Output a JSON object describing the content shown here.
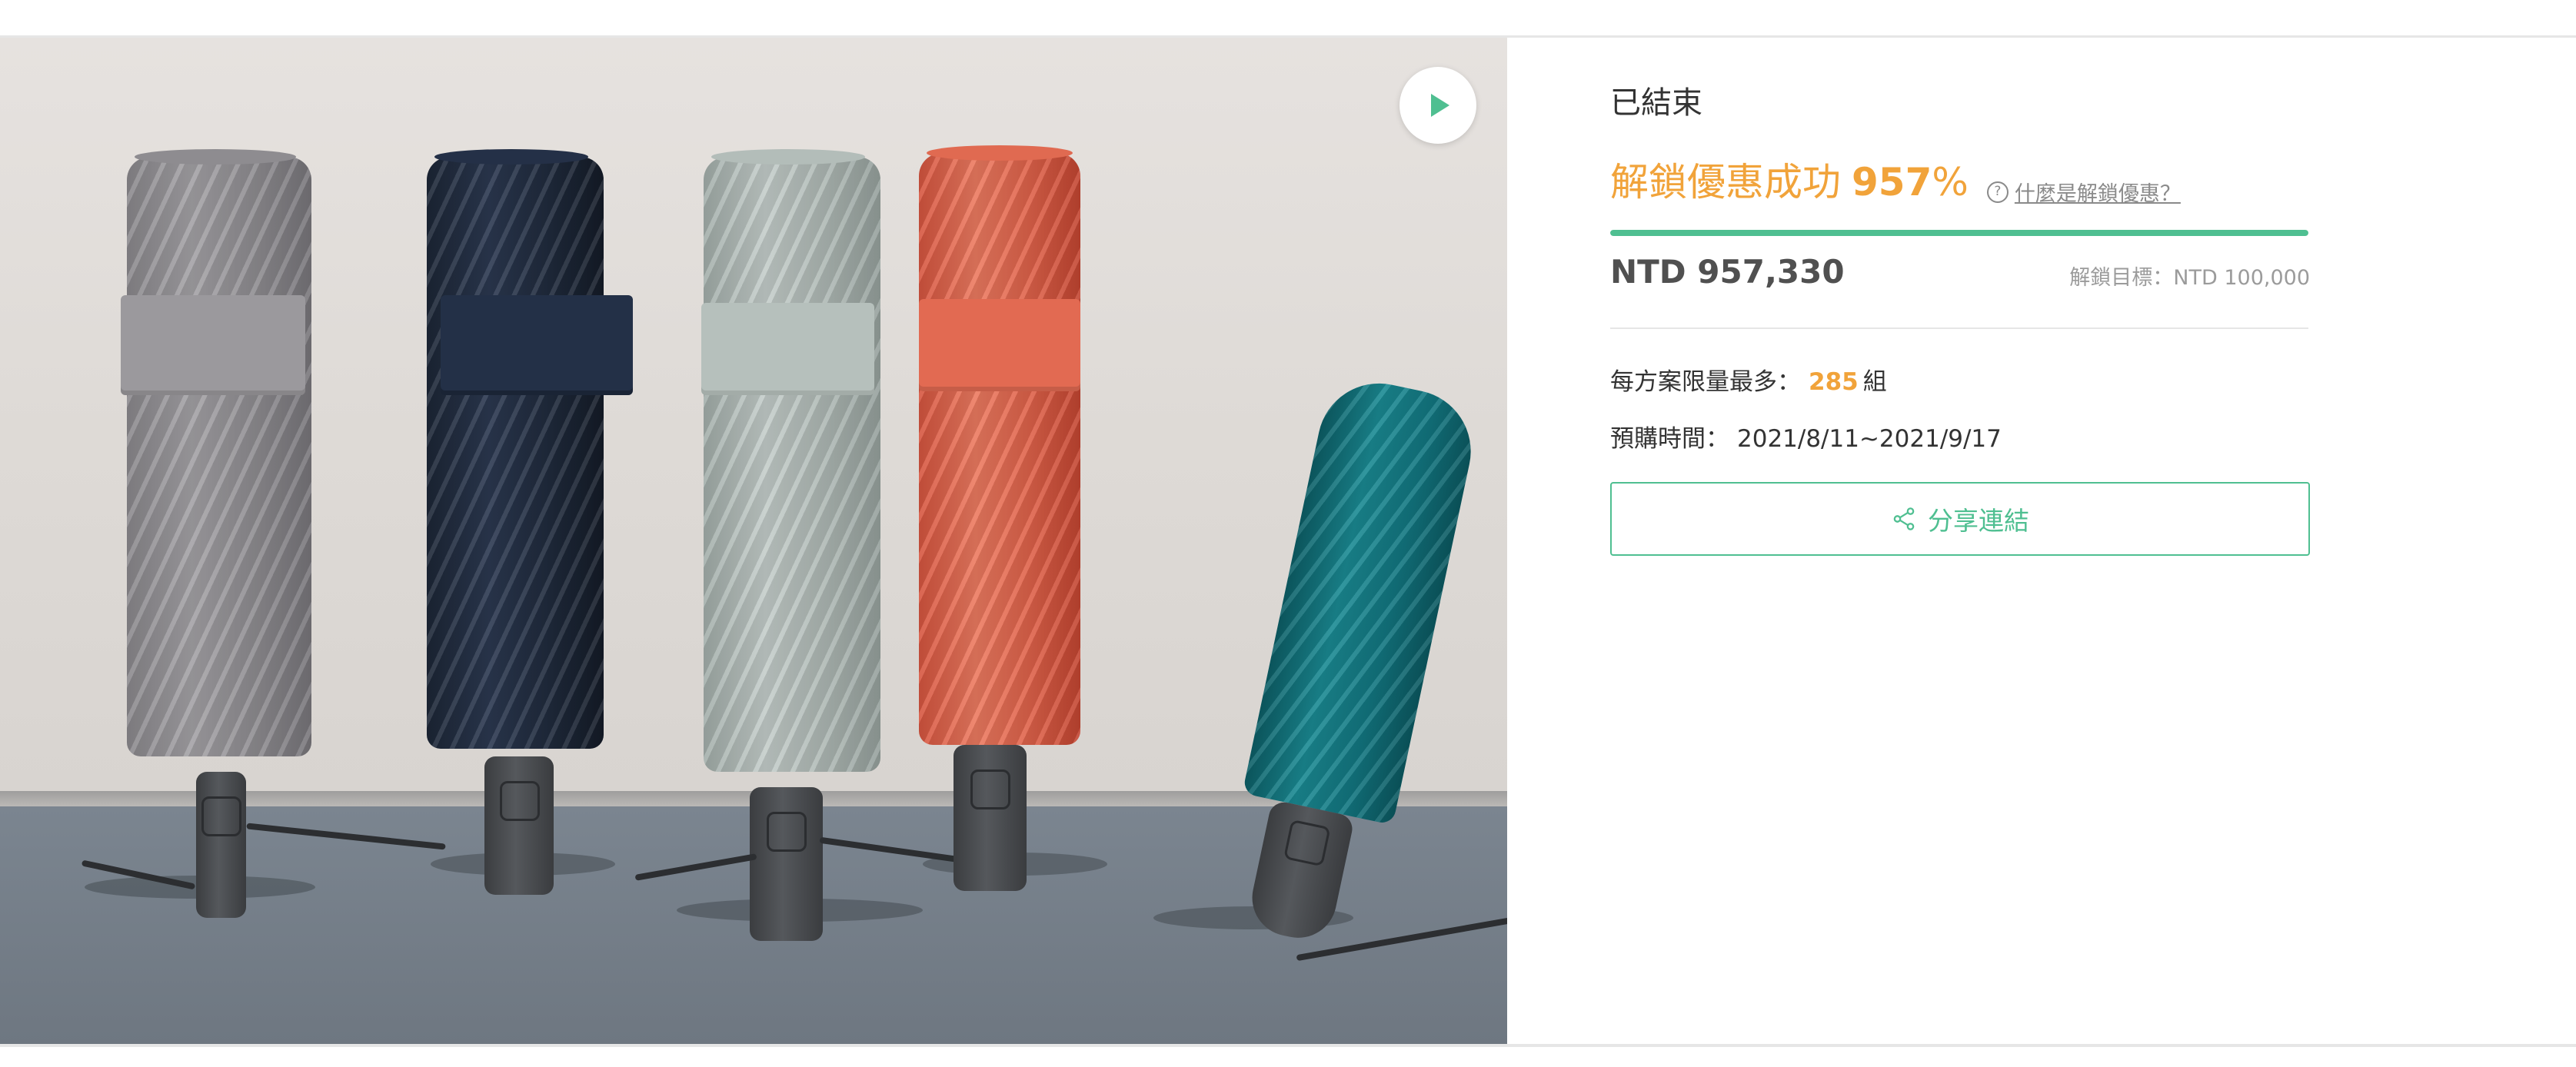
{
  "hero": {
    "media_icon": "play-icon",
    "image_subject": "umbrella-product-photo"
  },
  "campaign": {
    "status": "已結束",
    "unlock_label": "解鎖優惠成功",
    "unlock_percent_value": "957",
    "unlock_percent_sign": "%",
    "help_link": "什麼是解鎖優惠？",
    "help_icon": "question-circle-icon",
    "progress_fraction": 1.0,
    "amount": "NTD 957,330",
    "target": "解鎖目標：NTD 100,000",
    "limit_label": "每方案限量最多：",
    "limit_value": "285",
    "limit_unit": "組",
    "period_label": "預購時間：",
    "period_value": "2021/8/11~2021/9/17",
    "share_label": "分享連結",
    "share_icon": "share-icon"
  },
  "colors": {
    "accent_green": "#4fbf91",
    "accent_orange": "#f1a33a",
    "text_dark": "#333333",
    "text_muted": "#9b9b9b"
  }
}
